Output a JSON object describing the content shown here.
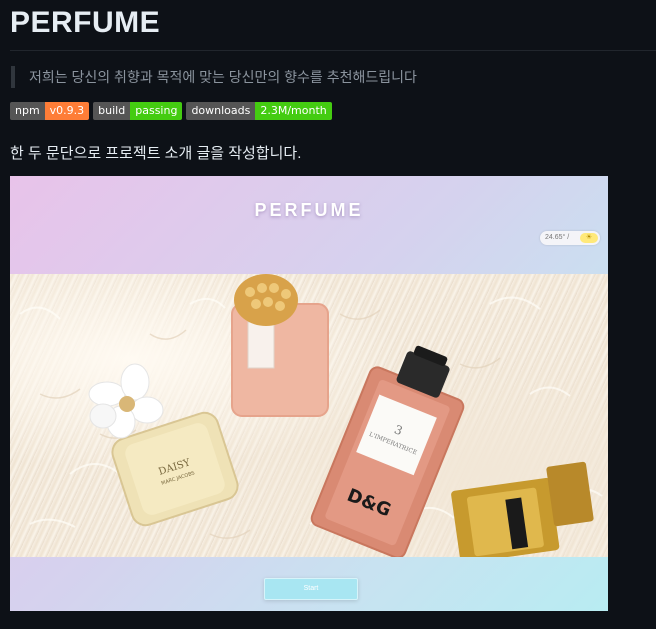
{
  "readme": {
    "title": "PERFUME",
    "tagline": "저희는 당신의 취향과 목적에 맞는 당신만의 향수를 추천해드립니다",
    "badges": [
      {
        "key": "npm",
        "value": "v0.9.3",
        "color": "#fe7d37"
      },
      {
        "key": "build",
        "value": "passing",
        "color": "#4c1"
      },
      {
        "key": "downloads",
        "value": "2.3M/month",
        "color": "#4c1"
      }
    ],
    "intro": "한 두 문단으로 프로젝트 소개 글을 작성합니다."
  },
  "preview": {
    "app_title": "PERFUME",
    "toggle_label": "24.65° /",
    "toggle_icon": "sun-icon",
    "start_label": "Start",
    "bottle_labels": {
      "daisy": "DAISY",
      "daisy_brand": "MARC JACOBS",
      "dg_number": "3",
      "dg_name": "L'IMPERATRICE",
      "dg_logo": "D&G"
    }
  }
}
